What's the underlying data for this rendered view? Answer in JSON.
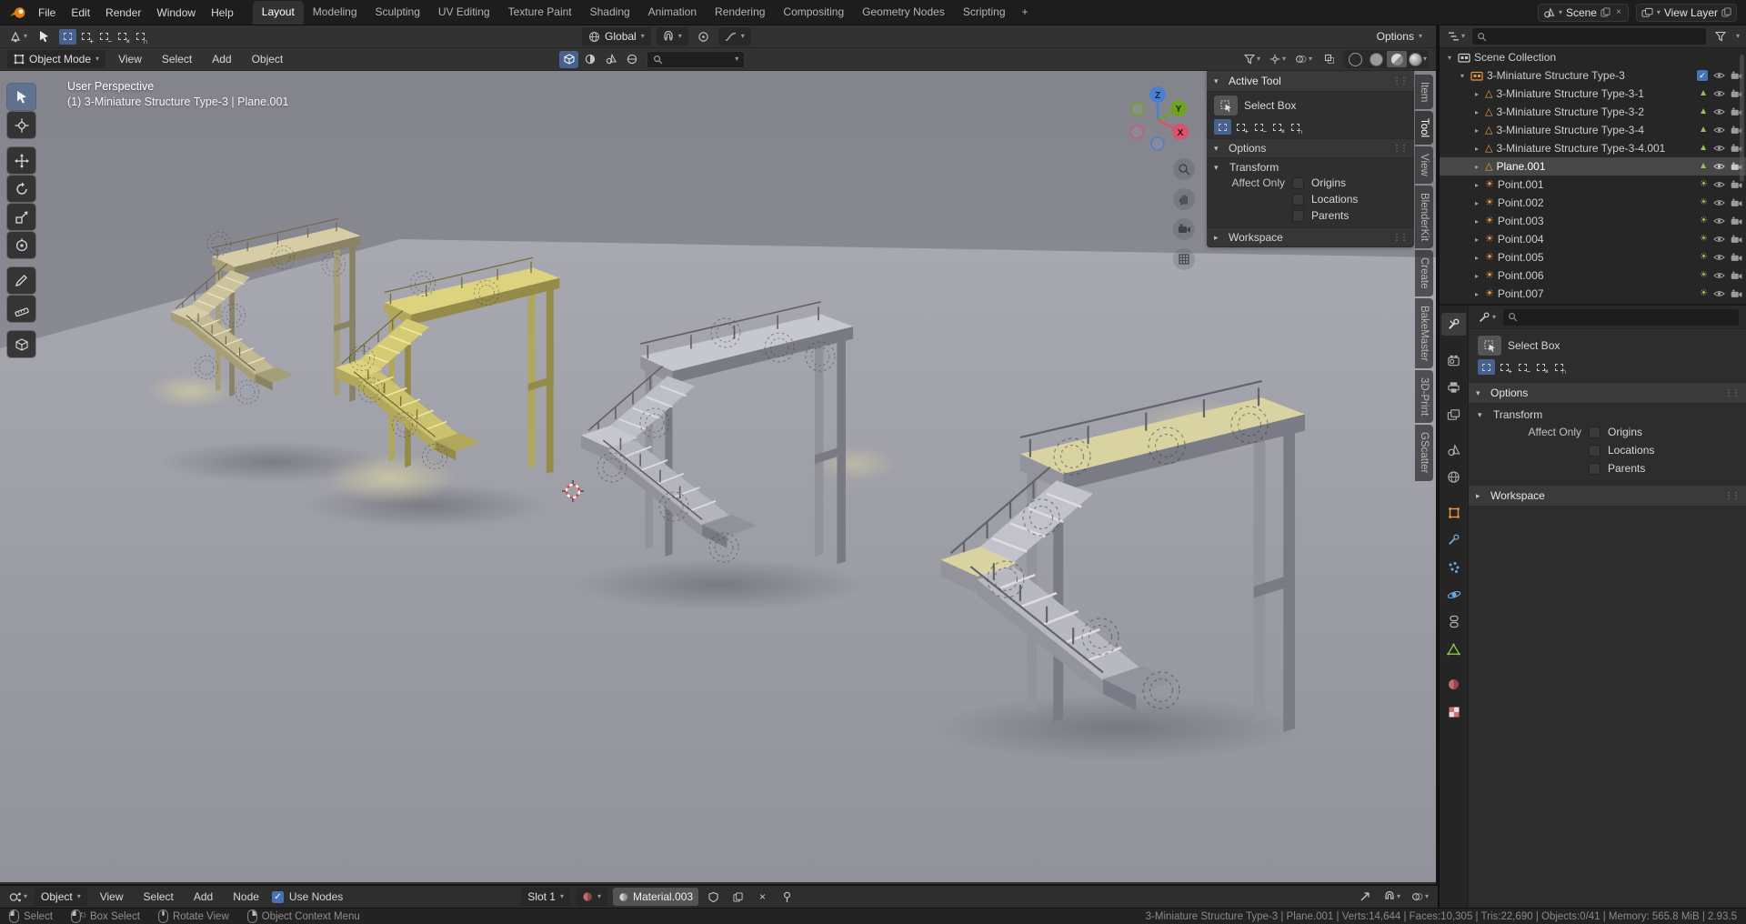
{
  "topbar": {
    "menus": [
      "File",
      "Edit",
      "Render",
      "Window",
      "Help"
    ],
    "workspaces": [
      "Layout",
      "Modeling",
      "Sculpting",
      "UV Editing",
      "Texture Paint",
      "Shading",
      "Animation",
      "Rendering",
      "Compositing",
      "Geometry Nodes",
      "Scripting"
    ],
    "active_workspace": "Layout",
    "add_workspace_label": "+",
    "scene": {
      "label": "Scene"
    },
    "view_layer": {
      "label": "View Layer"
    }
  },
  "tool_settings": {
    "transform_orientation": "Global",
    "options_label": "Options"
  },
  "viewport": {
    "header": {
      "mode": "Object Mode",
      "menus": [
        "View",
        "Select",
        "Add",
        "Object"
      ],
      "blenderkit_search_value": ""
    },
    "overlay": {
      "view_name": "User Perspective",
      "context": "(1) 3-Miniature Structure Type-3 | Plane.001"
    },
    "axis_gizmo": {
      "x": "X",
      "y": "Y",
      "z": "Z"
    },
    "tools": [
      "select-box",
      "cursor",
      "move",
      "rotate",
      "scale",
      "transform",
      "annotate",
      "measure",
      "add-cube"
    ],
    "sidebar_tabs": [
      "Item",
      "Tool",
      "View",
      "BlenderKit",
      "Create",
      "BakeMaster",
      "3D-Print",
      "GScatter"
    ],
    "active_sidebar_tab": "Tool"
  },
  "active_tool_panel": {
    "title": "Active Tool",
    "tool_name": "Select Box",
    "options": "Options",
    "transform": "Transform",
    "affect_only": "Affect Only",
    "origins": "Origins",
    "locations": "Locations",
    "parents": "Parents",
    "workspace": "Workspace"
  },
  "outliner": {
    "search_value": "",
    "scene_collection": "Scene Collection",
    "collection_name": "3-Miniature Structure Type-3",
    "items": [
      {
        "name": "3-Miniature Structure Type-3-1",
        "type": "mesh"
      },
      {
        "name": "3-Miniature Structure Type-3-2",
        "type": "mesh"
      },
      {
        "name": "3-Miniature Structure Type-3-4",
        "type": "mesh"
      },
      {
        "name": "3-Miniature Structure Type-3-4.001",
        "type": "mesh"
      },
      {
        "name": "Plane.001",
        "type": "mesh",
        "active": true
      },
      {
        "name": "Point.001",
        "type": "light"
      },
      {
        "name": "Point.002",
        "type": "light"
      },
      {
        "name": "Point.003",
        "type": "light"
      },
      {
        "name": "Point.004",
        "type": "light"
      },
      {
        "name": "Point.005",
        "type": "light"
      },
      {
        "name": "Point.006",
        "type": "light"
      },
      {
        "name": "Point.007",
        "type": "light"
      }
    ]
  },
  "properties_panel": {
    "search_value": "",
    "tabs": [
      "tool",
      "render",
      "output",
      "view-layer",
      "scene",
      "world",
      "object",
      "modifiers",
      "particles",
      "physics",
      "constraints",
      "object-data",
      "material",
      "texture"
    ],
    "active_tab": "tool",
    "tool_name": "Select Box",
    "options": "Options",
    "transform": "Transform",
    "affect_only": "Affect Only",
    "origins": "Origins",
    "locations": "Locations",
    "parents": "Parents",
    "workspace": "Workspace"
  },
  "shader_editor": {
    "shader_type": "Object",
    "menus": [
      "View",
      "Select",
      "Add",
      "Node"
    ],
    "use_nodes": "Use Nodes",
    "slot": "Slot 1",
    "material": "Material.003"
  },
  "status_bar": {
    "hints": [
      "Select",
      "Box Select",
      "Rotate View",
      "Object Context Menu"
    ],
    "stats": "3-Miniature Structure Type-3 | Plane.001 | Verts:14,644 | Faces:10,305 | Tris:22,690 | Objects:0/41 | Memory: 565.8 MiB | 2.93.5"
  },
  "colors": {
    "accent_blue": "#4772b3",
    "selection_orange": "#e8953c",
    "data_green": "#90c84f",
    "viewport_bg": "#90909a"
  }
}
